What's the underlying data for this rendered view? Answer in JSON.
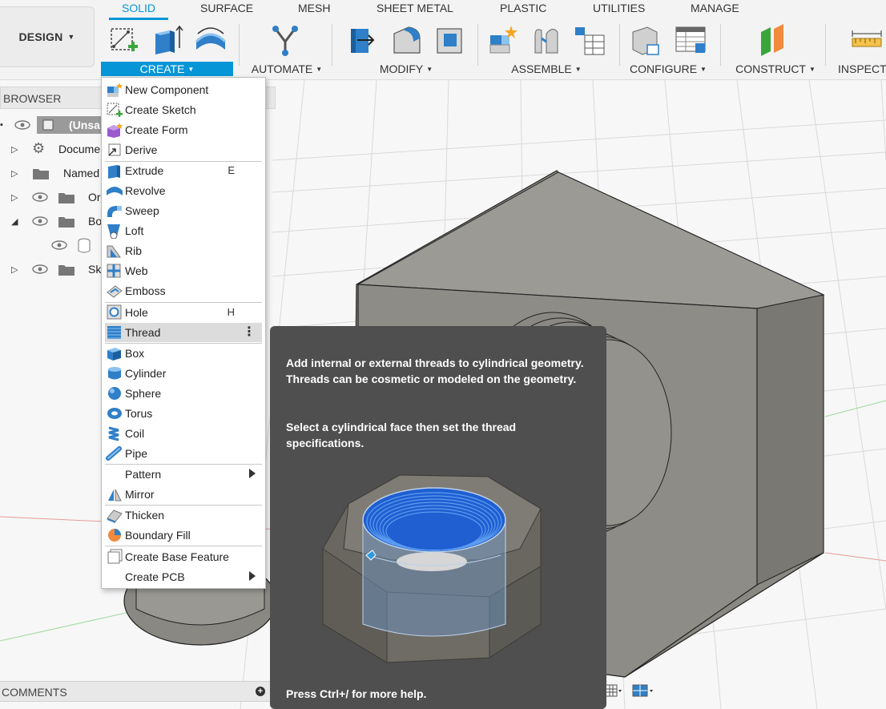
{
  "workspace": {
    "label": "DESIGN"
  },
  "tabs": [
    "SOLID",
    "SURFACE",
    "MESH",
    "SHEET METAL",
    "PLASTIC",
    "UTILITIES",
    "MANAGE"
  ],
  "groups": [
    "CREATE",
    "AUTOMATE",
    "MODIFY",
    "ASSEMBLE",
    "CONFIGURE",
    "CONSTRUCT",
    "INSPECT"
  ],
  "browser": {
    "title": "BROWSER",
    "items": [
      "(Unsa",
      "Docume",
      "Named",
      "Or",
      "Bo",
      "Sk"
    ]
  },
  "create_menu": {
    "items": [
      {
        "label": "New Component",
        "icon": "new-component-icon"
      },
      {
        "label": "Create Sketch",
        "icon": "create-sketch-icon"
      },
      {
        "label": "Create Form",
        "icon": "create-form-icon"
      },
      {
        "label": "Derive",
        "icon": "derive-icon"
      },
      {
        "label": "Extrude",
        "shortcut": "E",
        "icon": "extrude-icon"
      },
      {
        "label": "Revolve",
        "icon": "revolve-icon"
      },
      {
        "label": "Sweep",
        "icon": "sweep-icon"
      },
      {
        "label": "Loft",
        "icon": "loft-icon"
      },
      {
        "label": "Rib",
        "icon": "rib-icon"
      },
      {
        "label": "Web",
        "icon": "web-icon"
      },
      {
        "label": "Emboss",
        "icon": "emboss-icon"
      },
      {
        "label": "Hole",
        "shortcut": "H",
        "icon": "hole-icon"
      },
      {
        "label": "Thread",
        "icon": "thread-icon",
        "highlighted": true
      },
      {
        "label": "Box",
        "icon": "box-icon"
      },
      {
        "label": "Cylinder",
        "icon": "cylinder-icon"
      },
      {
        "label": "Sphere",
        "icon": "sphere-icon"
      },
      {
        "label": "Torus",
        "icon": "torus-icon"
      },
      {
        "label": "Coil",
        "icon": "coil-icon"
      },
      {
        "label": "Pipe",
        "icon": "pipe-icon"
      },
      {
        "label": "Pattern",
        "submenu": true
      },
      {
        "label": "Mirror",
        "icon": "mirror-icon"
      },
      {
        "label": "Thicken",
        "icon": "thicken-icon"
      },
      {
        "label": "Boundary Fill",
        "icon": "boundary-fill-icon"
      },
      {
        "label": "Create Base Feature",
        "icon": "base-feature-icon"
      },
      {
        "label": "Create PCB",
        "submenu": true
      }
    ]
  },
  "tooltip": {
    "description": "Add internal or external threads to cylindrical geometry. Threads can be cosmetic or modeled on the geometry.",
    "instruction": "Select a cylindrical face then set the thread specifications.",
    "help": "Press Ctrl+/ for more help."
  },
  "comments": {
    "label": "COMMENTS"
  },
  "colors": {
    "accent": "#0696d7",
    "tooltip_bg": "#4f4f4f",
    "model_face": "#8c8a85"
  }
}
